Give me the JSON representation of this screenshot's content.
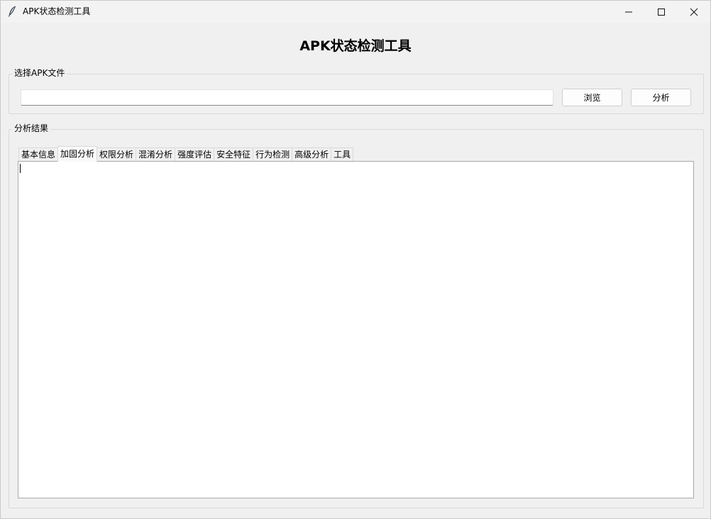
{
  "window": {
    "title": "APK状态检测工具",
    "controls": {
      "minimize": "minimize-icon",
      "maximize": "maximize-icon",
      "close": "close-icon"
    }
  },
  "heading": "APK状态检测工具",
  "file_group": {
    "legend": "选择APK文件",
    "path_value": "",
    "browse_label": "浏览",
    "analyze_label": "分析"
  },
  "result_group": {
    "legend": "分析结果",
    "tabs": [
      {
        "label": "基本信息",
        "active": false
      },
      {
        "label": "加固分析",
        "active": true
      },
      {
        "label": "权限分析",
        "active": false
      },
      {
        "label": "混淆分析",
        "active": false
      },
      {
        "label": "强度评估",
        "active": false
      },
      {
        "label": "安全特征",
        "active": false
      },
      {
        "label": "行为检测",
        "active": false
      },
      {
        "label": "高级分析",
        "active": false
      },
      {
        "label": "工具",
        "active": false
      }
    ],
    "output_text": ""
  }
}
